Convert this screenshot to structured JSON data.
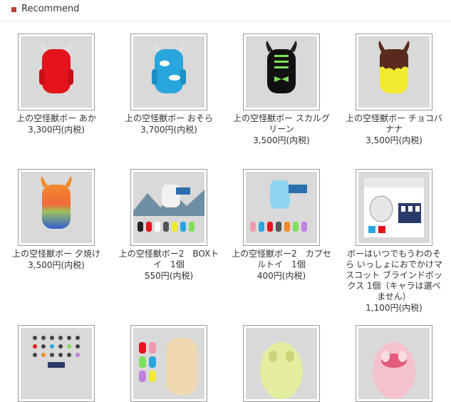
{
  "section": {
    "title": "Recommend"
  },
  "items": [
    {
      "name": "上の空怪獣ボー あか",
      "price": "3,300円(内税)"
    },
    {
      "name": "上の空怪獣ボー おそら",
      "price": "3,700円(内税)"
    },
    {
      "name": "上の空怪獣ボー スカルグリーン",
      "price": "3,500円(内税)"
    },
    {
      "name": "上の空怪獣ボー チョコバナナ",
      "price": "3,500円(内税)"
    },
    {
      "name": "上の空怪獣ボー 夕焼け",
      "price": "3,500円(内税)"
    },
    {
      "name": "上の空怪獣ボー2　BOXトイ　1個",
      "price": "550円(内税)"
    },
    {
      "name": "上の空怪獣ボー2　カプセルトイ　1個",
      "price": "400円(内税)"
    },
    {
      "name": "ボーはいつでもうわのそら いっしょにおでかけマスコット ブラインドボックス 1個（キャラは選べません）",
      "price": "1,100円(内税)"
    }
  ],
  "colors": {
    "accent": "#b4432f"
  }
}
